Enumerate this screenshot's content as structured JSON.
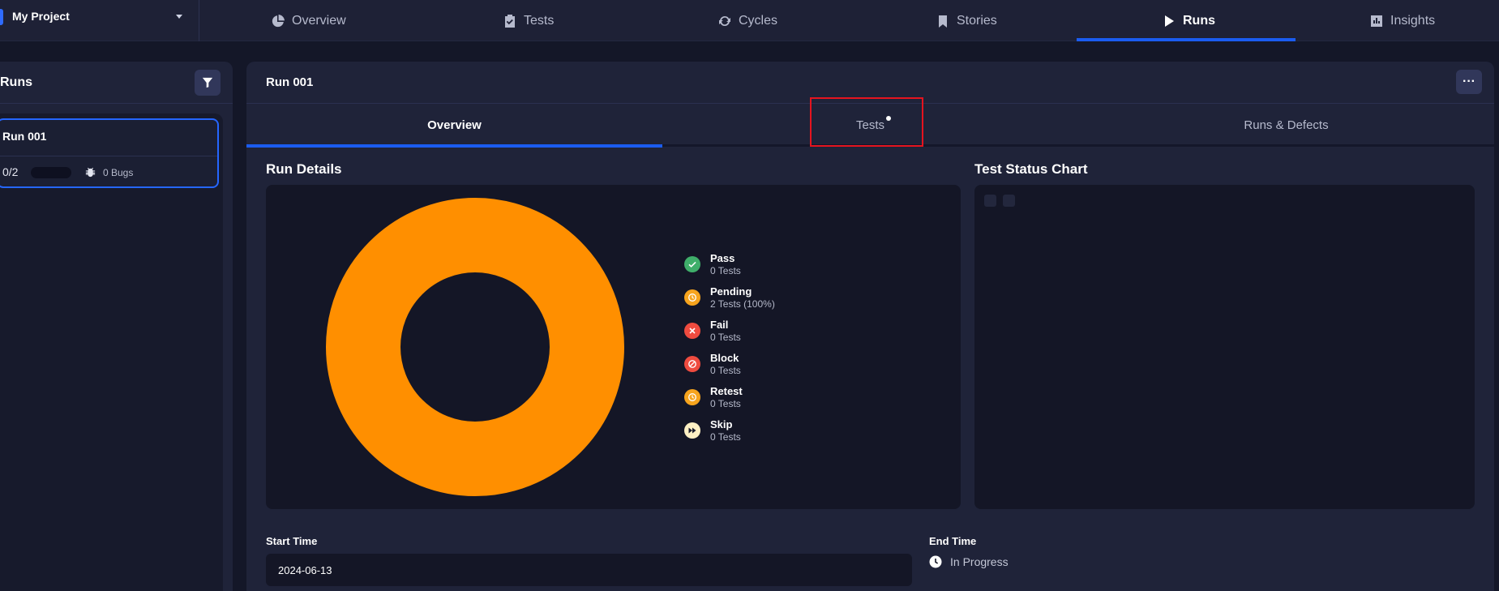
{
  "project": {
    "name": "My Project"
  },
  "nav": {
    "tabs": [
      {
        "label": "Overview",
        "icon": "pie-chart-icon"
      },
      {
        "label": "Tests",
        "icon": "clipboard-check-icon"
      },
      {
        "label": "Cycles",
        "icon": "cycle-icon"
      },
      {
        "label": "Stories",
        "icon": "bookmark-icon"
      },
      {
        "label": "Runs",
        "icon": "play-icon",
        "active": true
      },
      {
        "label": "Insights",
        "icon": "chart-icon"
      }
    ]
  },
  "runs_panel": {
    "title": "Runs",
    "items": [
      {
        "title": "Run 001",
        "count": "0/2",
        "progress": 0,
        "bugs": "0 Bugs"
      }
    ]
  },
  "run": {
    "title": "Run 001",
    "tabs": [
      {
        "label": "Overview",
        "active": true
      },
      {
        "label": "Tests",
        "has_indicator": true
      },
      {
        "label": "Runs & Defects"
      }
    ],
    "details_title": "Run Details",
    "status_chart_title": "Test Status Chart",
    "legend": [
      {
        "name": "Pass",
        "sub": "0 Tests",
        "color": "#3fae6a",
        "icon": "check-icon"
      },
      {
        "name": "Pending",
        "sub": "2 Tests (100%)",
        "color": "#f7a41d",
        "icon": "clock-icon"
      },
      {
        "name": "Fail",
        "sub": "0 Tests",
        "color": "#ef4b3f",
        "icon": "x-icon"
      },
      {
        "name": "Block",
        "sub": "0 Tests",
        "color": "#ef4b3f",
        "icon": "block-icon"
      },
      {
        "name": "Retest",
        "sub": "0 Tests",
        "color": "#f7a41d",
        "icon": "clock-icon"
      },
      {
        "name": "Skip",
        "sub": "0 Tests",
        "color": "#fdf0c4",
        "icon": "fast-forward-icon"
      }
    ],
    "donut": {
      "pending_fraction": 1.0,
      "color": "#ff8f00"
    },
    "start_time_label": "Start Time",
    "start_time_value": "2024-06-13",
    "end_time_label": "End Time",
    "end_time_value": "In Progress"
  },
  "colors": {
    "accent": "#1b5cf0",
    "highlight": "#e5141f"
  }
}
